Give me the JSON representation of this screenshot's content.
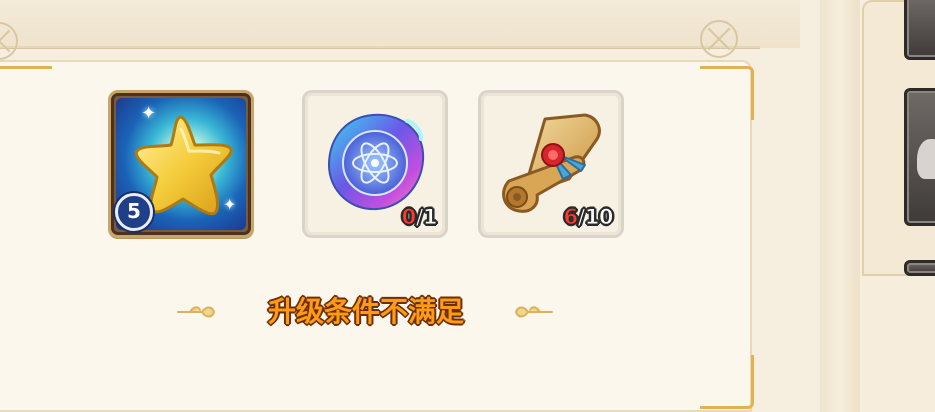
{
  "materials": {
    "featured": {
      "icon": "gold-star-icon",
      "level": "5"
    },
    "orb": {
      "icon": "prism-orb-icon",
      "have": "0",
      "need": "/1"
    },
    "scroll": {
      "icon": "sealed-scroll-icon",
      "have": "6",
      "need": "/10"
    }
  },
  "upgrade": {
    "condition_text": "升级条件不满足"
  },
  "colors": {
    "insufficient": "#ff3b30",
    "warning_text": "#ff9a14",
    "gold_frame": "#e0b253"
  }
}
